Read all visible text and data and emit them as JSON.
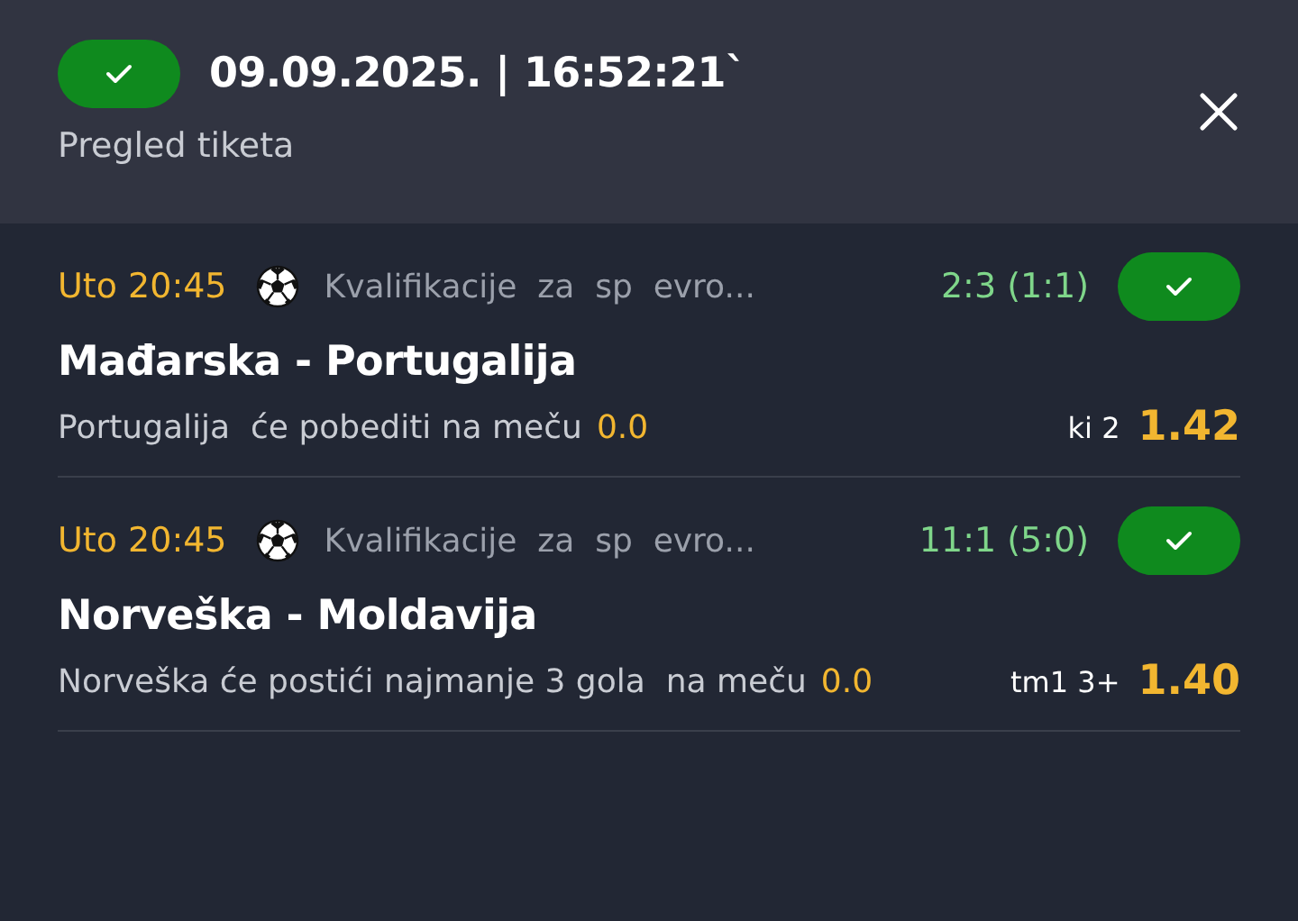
{
  "header": {
    "won": true,
    "title": "09.09.2025. | 16:52:21`",
    "subtitle": "Pregled tiketa"
  },
  "matches": [
    {
      "time": "Uto 20:45",
      "league": "Kvalifikacije  za  sp  evro...",
      "score": "2:3 (1:1)",
      "won": true,
      "teams": "Mađarska - Portugalija",
      "pick": "Portugalija  će pobediti na meču",
      "pick_value": "0.0",
      "market": "ki 2",
      "odds": "1.42"
    },
    {
      "time": "Uto 20:45",
      "league": "Kvalifikacije  za  sp  evro...",
      "score": "11:1 (5:0)",
      "won": true,
      "teams": "Norveška - Moldavija",
      "pick": "Norveška će postići najmanje 3 gola  na meču",
      "pick_value": "0.0",
      "market": "tm1 3+",
      "odds": "1.40"
    }
  ]
}
